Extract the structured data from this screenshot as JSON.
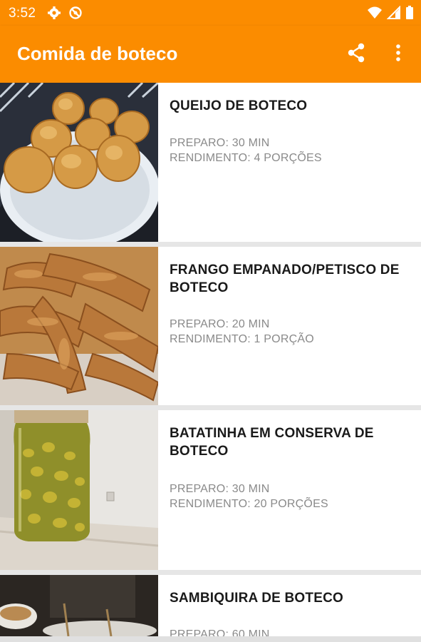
{
  "status_bar": {
    "time": "3:52",
    "left_icons": [
      "gear-icon",
      "no-disturb-icon"
    ],
    "right_icons": [
      "wifi-icon",
      "cell-signal-icon",
      "battery-icon"
    ]
  },
  "app_bar": {
    "title": "Comida de boteco",
    "actions": [
      "share-icon",
      "more-vert-icon"
    ],
    "color": "#fb8c00"
  },
  "recipes": [
    {
      "title": "QUEIJO DE BOTECO",
      "preparo": "PREPARO: 30 MIN",
      "rendimento": "RENDIMENTO: 4 PORÇÕES",
      "image": "fried-cheese-photo"
    },
    {
      "title": "FRANGO EMPANADO/PETISCO DE BOTECO",
      "preparo": "PREPARO: 20 MIN",
      "rendimento": "RENDIMENTO: 1 PORÇÃO",
      "image": "breaded-chicken-photo"
    },
    {
      "title": "BATATINHA EM CONSERVA DE BOTECO",
      "preparo": "PREPARO: 30 MIN",
      "rendimento": "RENDIMENTO: 20 PORÇÕES",
      "image": "pickled-potatoes-jar-photo"
    },
    {
      "title": "SAMBIQUIRA DE BOTECO",
      "preparo": "PREPARO: 60 MIN",
      "image": "sambiquira-photo"
    }
  ]
}
